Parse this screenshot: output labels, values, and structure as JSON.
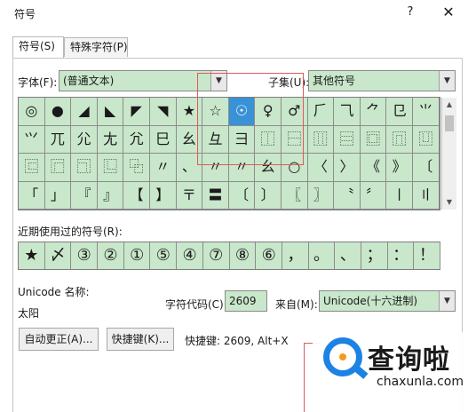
{
  "window": {
    "title": "符号",
    "help": "?",
    "close": "✕"
  },
  "tabs": [
    {
      "label": "符号(S)"
    },
    {
      "label": "特殊字符(P)"
    }
  ],
  "font": {
    "label": "字体(F):",
    "value": "(普通文本)"
  },
  "subset": {
    "label": "子集(U):",
    "value": "其他符号"
  },
  "grid_rows": [
    [
      "◎",
      "●",
      "◢",
      "◣",
      "◤",
      "◥",
      "★",
      "☆",
      "☉",
      "♀",
      "♂",
      "⺁",
      "⺄",
      "⺈",
      "⺋",
      "⺌"
    ],
    [
      "⺍",
      "⺎",
      "⺏",
      "⺐",
      "⺑",
      "⺒",
      "⺓",
      "⺔",
      "⺕",
      "⿰",
      "⿱",
      "⿲",
      "⿳",
      "⿴",
      "⿵",
      "⿶"
    ],
    [
      "⿷",
      "⿸",
      "⿹",
      "⿺",
      "⿻",
      "〃",
      "、",
      "〃",
      "〃",
      "⺓",
      "○",
      "〈",
      "〉",
      "《",
      "》",
      "〔"
    ],
    [
      "「",
      "」",
      "『",
      "』",
      "【",
      "】",
      "〒",
      "〓",
      "〔",
      "〕",
      "〖",
      "〗",
      "〝",
      "〞",
      "〡",
      "〢"
    ]
  ],
  "selected_cell": {
    "row": 0,
    "col": 8
  },
  "recent": {
    "label": "近期使用过的符号(R):",
    "items": [
      "★",
      "〆",
      "③",
      "②",
      "①",
      "⑤",
      "④",
      "⑦",
      "⑧",
      "⑥",
      "，",
      "。",
      "、",
      "；",
      "：",
      "！"
    ]
  },
  "unicode_name": {
    "label": "Unicode 名称:",
    "value": "太阳"
  },
  "char_code": {
    "label": "字符代码(C):",
    "value": "2609"
  },
  "from": {
    "label": "来自(M):",
    "value": "Unicode(十六进制)"
  },
  "buttons": {
    "autocorrect": "自动更正(A)...",
    "shortcut_key": "快捷键(K)..."
  },
  "shortcut_info": "快捷键: 2609, Alt+X",
  "watermark": {
    "text": "查询啦",
    "url": "chaxunla.com"
  },
  "colors": {
    "grid_bg": "#c9e7cb",
    "selected": "#3a92d6",
    "annotation": "#e05a5a",
    "logo_blue": "#1c82e3",
    "logo_orange": "#f39b1f"
  }
}
